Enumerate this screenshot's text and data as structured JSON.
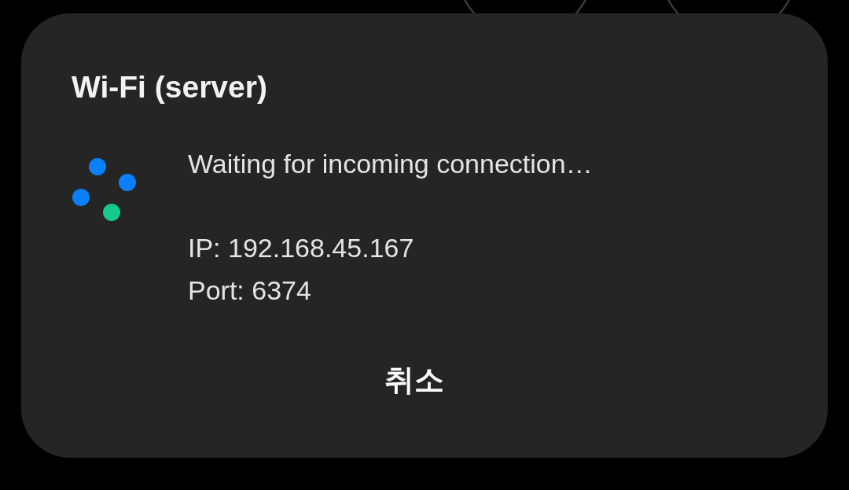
{
  "dialog": {
    "title": "Wi-Fi (server)",
    "message": "Waiting for incoming connection…",
    "details": [
      "IP: 192.168.45.167",
      "Port: 6374"
    ],
    "buttons": [
      "취소"
    ]
  }
}
